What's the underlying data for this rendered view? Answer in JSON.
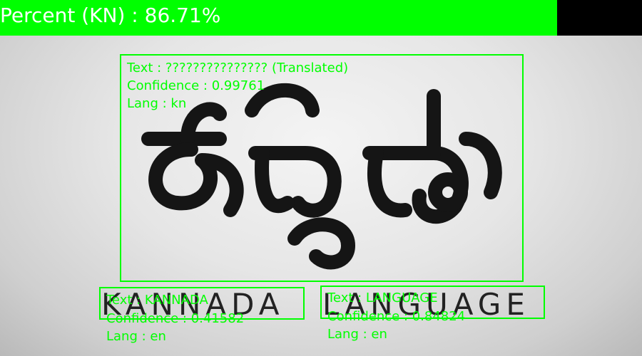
{
  "banner": {
    "text": "Percent (KN) : 86.71%",
    "color": "#00ff00"
  },
  "sign": {
    "kannada_glyphs": "ಕನ್ನಡ",
    "word1": "KANNADA",
    "word2": "LANGUAGE"
  },
  "detections": [
    {
      "text_line": "Text : ??????????????? (Translated)",
      "confidence_line": "Confidence : 0.99761",
      "lang_line": "Lang : kn"
    },
    {
      "text_line": "Text : KANNADA",
      "confidence_line": "Confidence : 0.41582",
      "lang_line": "Lang : en"
    },
    {
      "text_line": "Text : LANGUAGE",
      "confidence_line": "Confidence : 0.84824",
      "lang_line": "Lang : en"
    }
  ],
  "box_color": "#00ff00"
}
